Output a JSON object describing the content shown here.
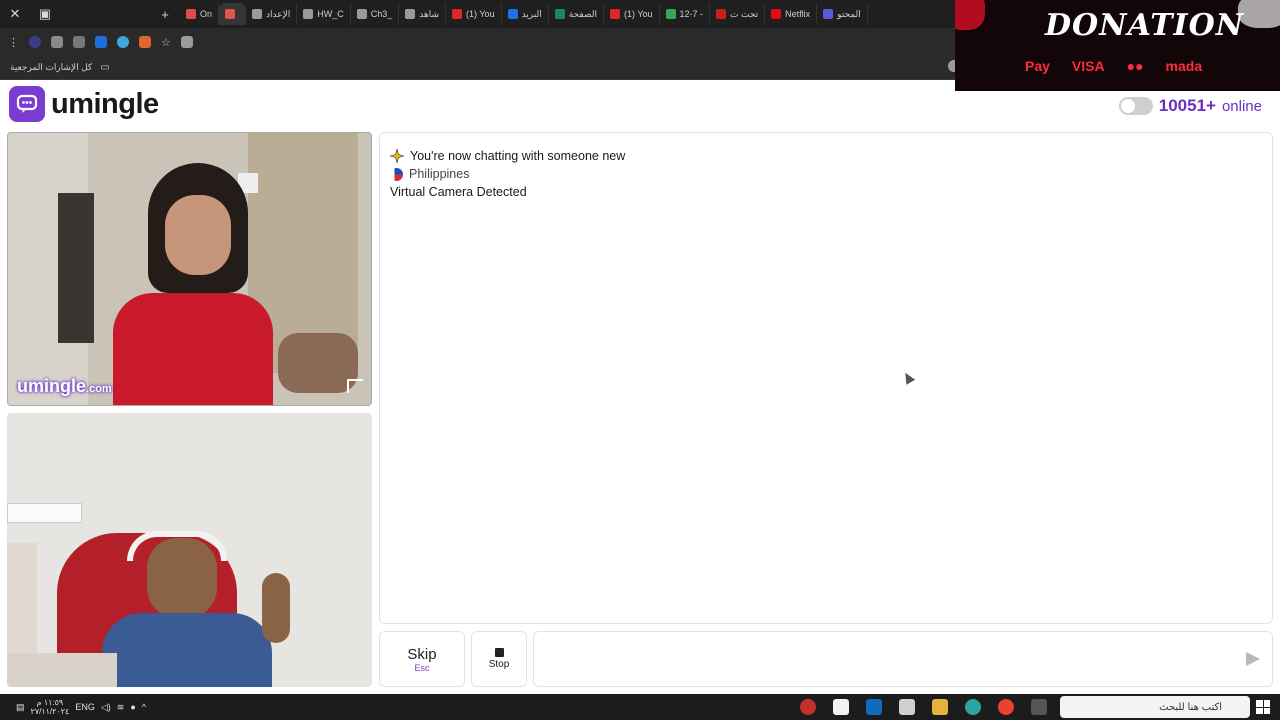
{
  "browser": {
    "tabs": [
      {
        "label": "On",
        "color": "#e04a4a"
      },
      {
        "label": "",
        "color": "#e0544a",
        "active": true
      },
      {
        "label": "الإعداد",
        "color": "#9a9a9a"
      },
      {
        "label": "HW_C",
        "color": "#9a9a9a"
      },
      {
        "label": "Ch3_",
        "color": "#9a9a9a"
      },
      {
        "label": "شاهد",
        "color": "#9a9a9a"
      },
      {
        "label": "(1) You",
        "color": "#e02626"
      },
      {
        "label": "البريد",
        "color": "#1a73e8"
      },
      {
        "label": "الصفحة",
        "color": "#1a8a5a"
      },
      {
        "label": "(1) You",
        "color": "#e02626"
      },
      {
        "label": "12-7 -",
        "color": "#34a853"
      },
      {
        "label": "تحت ت",
        "color": "#c5221f"
      },
      {
        "label": "Netflix",
        "color": "#e50914"
      },
      {
        "label": "المحتو",
        "color": "#5b5bd6"
      }
    ],
    "bookmarks_label": "كل الإشارات المرجعية"
  },
  "donation": {
    "title": "DONATION",
    "methods": [
      "Pay",
      "VISA",
      "●●",
      "mada"
    ]
  },
  "header": {
    "brand": "umingle",
    "online_count": "10051+",
    "online_label": "online"
  },
  "videos": {
    "watermark": "umingle",
    "watermark_suffix": ".com"
  },
  "chat": {
    "messages": [
      {
        "text": "You're now chatting with someone new",
        "icon": "sparkle-icon"
      },
      {
        "text": "Philippines",
        "icon": "philippines-flag-icon"
      },
      {
        "text": "Virtual Camera Detected"
      }
    ]
  },
  "controls": {
    "skip_label": "Skip",
    "skip_key": "Esc",
    "stop_label": "Stop",
    "message_placeholder": ""
  },
  "taskbar": {
    "lang": "ENG",
    "time": "١١:٥٩ م",
    "date": "٢٧/١١/٢٠٢٤",
    "search_placeholder": "اكتب هنا للبحث"
  },
  "colors": {
    "brand": "#7a3bd0",
    "online": "#6b2fc6"
  }
}
